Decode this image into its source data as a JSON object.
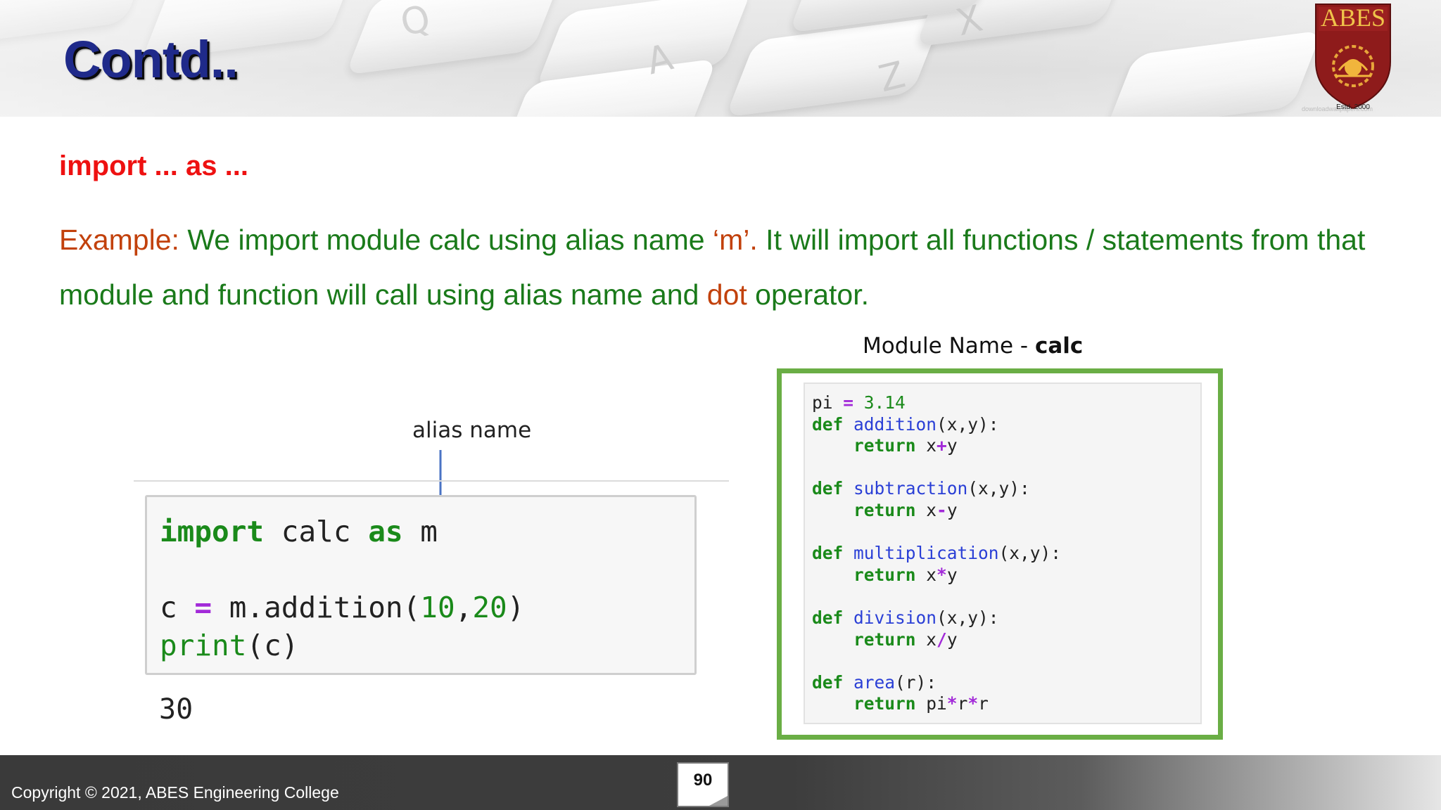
{
  "header": {
    "title": "Contd..",
    "logo_text": "ABES",
    "logo_est": "Estd. 2000",
    "watermark": "downloadwallpapers.com"
  },
  "content": {
    "subheading": "import ... as ...",
    "paragraph": {
      "example_label": "Example:",
      "part1": " We import module calc using alias name ",
      "alias_quoted": "‘m’.",
      "part2": " It will import all functions / statements from that module and function will call using alias name and ",
      "dot_word": "dot",
      "part3": " operator."
    }
  },
  "notebook": {
    "alias_label": "alias name",
    "code_lines": [
      "import calc as m",
      "",
      "c = m.addition(10,20)",
      "print(c)"
    ],
    "output": "30"
  },
  "module": {
    "caption_prefix": "Module Name - ",
    "caption_name": "calc",
    "code_lines": [
      "pi = 3.14",
      "def addition(x,y):",
      "    return x+y",
      "",
      "def subtraction(x,y):",
      "    return x-y",
      "",
      "def multiplication(x,y):",
      "    return x*y",
      "",
      "def division(x,y):",
      "    return x/y",
      "",
      "def area(r):",
      "    return pi*r*r"
    ]
  },
  "footer": {
    "copyright": "Copyright © 2021, ABES Engineering College",
    "page_number": "90"
  },
  "colors": {
    "title": "#1f2a8a",
    "subheading": "#ee1111",
    "body_text": "#1a7a1a",
    "highlight": "#c2410c",
    "module_border": "#6aae45",
    "keyword": "#1a8a1a",
    "operator": "#a22ad8",
    "function_name": "#2a3fd6"
  }
}
